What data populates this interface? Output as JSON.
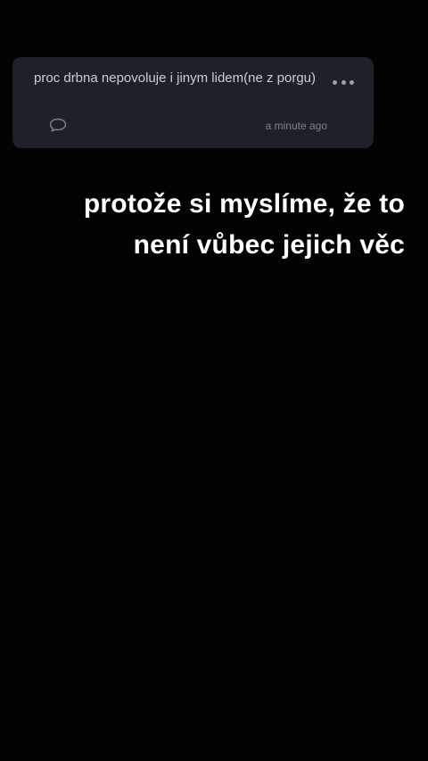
{
  "question_card": {
    "text": "proc drbna nepovoluje i jinym lidem(ne z porgu)",
    "timestamp": "a minute ago",
    "more_icon": "more-horizontal-icon",
    "reply_icon": "speech-bubble-icon"
  },
  "answer": {
    "line1": "protože si myslíme, že to",
    "line2": "není vůbec jejich věc"
  },
  "colors": {
    "background": "#030303",
    "card": "#1d2129",
    "card_text": "#c9ced8",
    "muted": "#7c8391",
    "answer_text": "#ffffff"
  }
}
